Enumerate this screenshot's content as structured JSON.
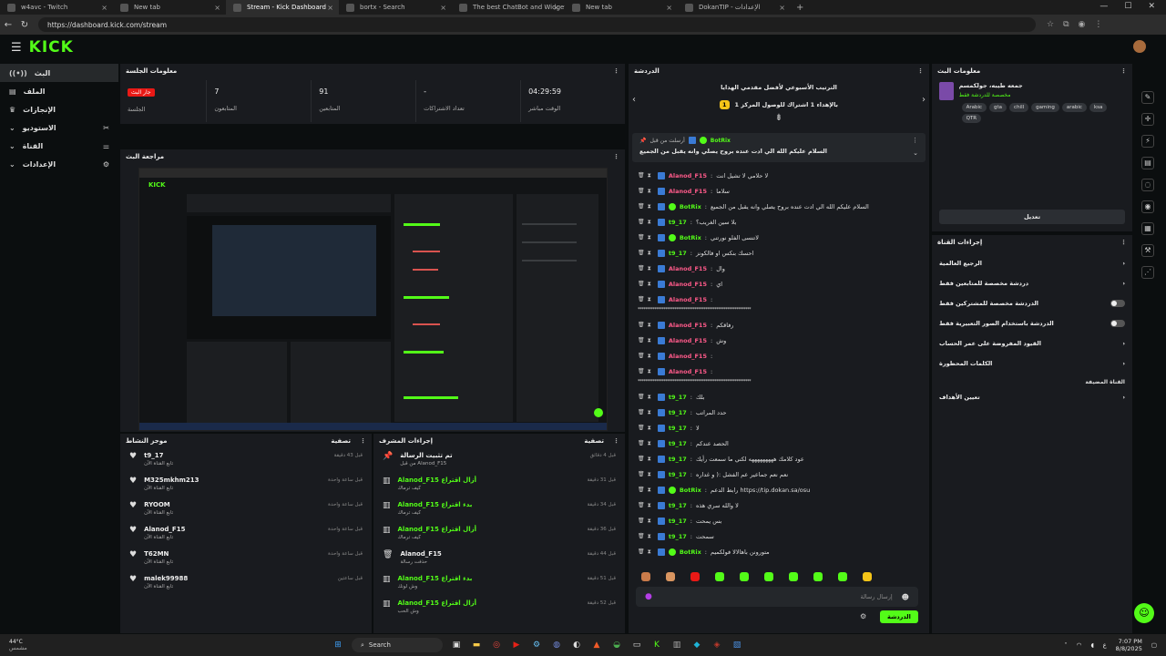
{
  "browser": {
    "tabs": [
      {
        "label": "w4avc - Twitch",
        "active": false
      },
      {
        "label": "New tab",
        "active": false
      },
      {
        "label": "Stream - Kick Dashboard",
        "active": true
      },
      {
        "label": "bortx - Search",
        "active": false
      },
      {
        "label": "The best ChatBot and Widgets fo",
        "active": false
      },
      {
        "label": "New tab",
        "active": false
      },
      {
        "label": "DokanTIP - الإعدادات",
        "active": false
      }
    ],
    "url": "https://dashboard.kick.com/stream"
  },
  "app": {
    "logo": "KICK"
  },
  "nav": {
    "items": [
      {
        "label": "البث",
        "icon": "radio-icon",
        "active": true
      },
      {
        "label": "الملف",
        "icon": "file-icon",
        "active": false
      },
      {
        "label": "الإنجازات",
        "icon": "trophy-icon",
        "active": false
      },
      {
        "label": "الاستوديو",
        "icon": "tools-icon",
        "active": false
      },
      {
        "label": "القناة",
        "icon": "sliders-icon",
        "active": false
      },
      {
        "label": "الإعدادات",
        "icon": "gear-icon",
        "active": false
      }
    ]
  },
  "session": {
    "title": "معلومات الجلسة",
    "live_badge": "جار البث",
    "live_label": "الجلسة",
    "stats": [
      {
        "value": "7",
        "label": "المتابعون"
      },
      {
        "value": "91",
        "label": "المتابعين"
      },
      {
        "value": "-",
        "label": "تعداد الاشتراكات"
      },
      {
        "value": "04:29:59",
        "label": "الوقت مباشر"
      }
    ]
  },
  "preview": {
    "title": "مراجعة البث"
  },
  "feed": {
    "title": "موجز النشاط",
    "filter": "تصفية",
    "items": [
      {
        "name": "t9_17",
        "sub": "تابع القناة الآن",
        "time": "قبل 43 دقيقة"
      },
      {
        "name": "M325mkhm213",
        "sub": "تابع القناة الآن",
        "time": "قبل ساعة واحدة"
      },
      {
        "name": "RYOOM",
        "sub": "تابع القناة الآن",
        "time": "قبل ساعة واحدة"
      },
      {
        "name": "Alanod_F15",
        "sub": "تابع القناة الآن",
        "time": "قبل ساعة واحدة"
      },
      {
        "name": "T62MN",
        "sub": "تابع القناة الآن",
        "time": "قبل ساعة واحدة"
      },
      {
        "name": "malek99988",
        "sub": "تابع القناة الآن",
        "time": "قبل ساعتين"
      }
    ]
  },
  "mod_actions": {
    "title": "إجراءات المشرف",
    "filter": "تصفية",
    "items": [
      {
        "icon": "pin-icon",
        "title": "تم تثبيت الرسالة",
        "by": "من قبل Alanod_F15",
        "time": "قبل 4 دقائق",
        "green": false
      },
      {
        "icon": "poll-icon",
        "title": "Alanod_F15 أزال اقتراع",
        "by": "كيف ترماك",
        "time": "قبل 31 دقيقة",
        "green": true
      },
      {
        "icon": "poll-icon",
        "title": "Alanod_F15 بدء اقتراع",
        "by": "كيف ترماك",
        "time": "قبل 34 دقيقة",
        "green": true
      },
      {
        "icon": "poll-icon",
        "title": "Alanod_F15 أزال اقتراع",
        "by": "كيف ترماك",
        "time": "قبل 36 دقيقة",
        "green": true
      },
      {
        "icon": "trash-icon",
        "title": "Alanod_F15",
        "by": "حذفت رسالة",
        "time": "قبل 44 دقيقة",
        "green": false
      },
      {
        "icon": "poll-icon",
        "title": "Alanod_F15 بدء اقتراع",
        "by": "وش لونك",
        "time": "قبل 51 دقيقة",
        "green": true
      },
      {
        "icon": "poll-icon",
        "title": "Alanod_F15 أزال اقتراع",
        "by": "وش الحب",
        "time": "قبل 52 دقيقة",
        "green": true
      }
    ]
  },
  "chat": {
    "title": "الدردشة",
    "goal_title": "الترتيب الأسبوعي لأفضل مقدمي الهدايا",
    "goal_rank": "بالإهداء 1 اشتراك للوصول المركز 1",
    "goal_rank_num": "1",
    "pinned_by": "أرسلت من قبل",
    "pinned_user": "BotRix",
    "pinned_text": "السلام عليكم الله الي ادت عنده بروح يصلي وانه يقبل من الجميع",
    "messages": [
      {
        "user": "Alanod_F15",
        "color": "pink",
        "text": "لا حلامي لا تشيل انت"
      },
      {
        "user": "Alanod_F15",
        "color": "pink",
        "text": "سلاما"
      },
      {
        "user": "BotRix",
        "color": "green",
        "text": "السلام عليكم الله الي ادت عنده بروح يصلي وانه يقبل من الجميع"
      },
      {
        "user": "t9_17",
        "color": "green",
        "text": "بلا سين الغريب؟"
      },
      {
        "user": "BotRix",
        "color": "green",
        "text": "لاتنسى الفلو نورتني"
      },
      {
        "user": "t9_17",
        "color": "green",
        "text": "احسك بنكس او فالكونز"
      },
      {
        "user": "Alanod_F15",
        "color": "pink",
        "text": "وال"
      },
      {
        "user": "Alanod_F15",
        "color": "pink",
        "text": "اي"
      },
      {
        "user": "Alanod_F15",
        "color": "pink",
        "text": ""
      },
      {
        "user": "",
        "color": "stars",
        "text": "**************************************************************"
      },
      {
        "user": "Alanod_F15",
        "color": "pink",
        "text": "رفاقكم"
      },
      {
        "user": "Alanod_F15",
        "color": "pink",
        "text": "وش"
      },
      {
        "user": "Alanod_F15",
        "color": "pink",
        "text": ""
      },
      {
        "user": "Alanod_F15",
        "color": "pink",
        "text": ""
      },
      {
        "user": "",
        "color": "stars",
        "text": "**************************************************************"
      },
      {
        "user": "t9_17",
        "color": "green",
        "text": "بلك"
      },
      {
        "user": "t9_17",
        "color": "green",
        "text": "حدد المراتب"
      },
      {
        "user": "t9_17",
        "color": "green",
        "text": "لا"
      },
      {
        "user": "t9_17",
        "color": "green",
        "text": "الحصد عندكم"
      },
      {
        "user": "t9_17",
        "color": "green",
        "text": "عود كلامك هههههههههه لكني ما سمعت رأيك"
      },
      {
        "user": "t9_17",
        "color": "green",
        "text": "نعم نعم جماعير عم الفشل :( و غداره"
      },
      {
        "user": "BotRix",
        "color": "green",
        "text": "رابط الدعم https://tip.dokan.sa/osu"
      },
      {
        "user": "t9_17",
        "color": "green",
        "text": "لا والله سري هذه"
      },
      {
        "user": "t9_17",
        "color": "green",
        "text": "بس يمحت"
      },
      {
        "user": "t9_17",
        "color": "green",
        "text": "سمحت"
      },
      {
        "user": "BotRix",
        "color": "green",
        "text": "متورونن باهالالا فولكميم"
      }
    ],
    "input_placeholder": "إرسال رسالة",
    "send_label": "الدردشة"
  },
  "stream_info": {
    "title": "معلومات البث",
    "stream_title": "جمعه طيبه، جولكمسم",
    "category": "مخصصة للدردشة فقط",
    "tags": [
      "Arabic",
      "gta",
      "chill",
      "gaming",
      "arabic",
      "ksa",
      "QTR"
    ],
    "edit_label": "تعديل"
  },
  "channel_actions": {
    "title": "إجراءات القناة",
    "items": [
      {
        "label": "الرجيع العالمية",
        "type": "chevron"
      },
      {
        "label": "دردشة مخصصة للمتابعين فقط",
        "type": "chevron"
      },
      {
        "label": "الدردشة مخصصة للمشتركين فقط",
        "type": "toggle"
      },
      {
        "label": "الدردشة باستخدام الصور التعبيرية فقط",
        "type": "toggle"
      },
      {
        "label": "القيود المفروضة على عمر الحساب",
        "type": "chevron"
      },
      {
        "label": "الكلمات المحظورة",
        "type": "chevron"
      }
    ],
    "section_label": "القناة المضيفة",
    "goals_label": "تعيين الأهداف"
  },
  "taskbar": {
    "weather_temp": "44°C",
    "weather_desc": "مشمس",
    "search": "Search",
    "lang": "ع",
    "time": "7:07 PM",
    "date": "8/8/2025"
  }
}
